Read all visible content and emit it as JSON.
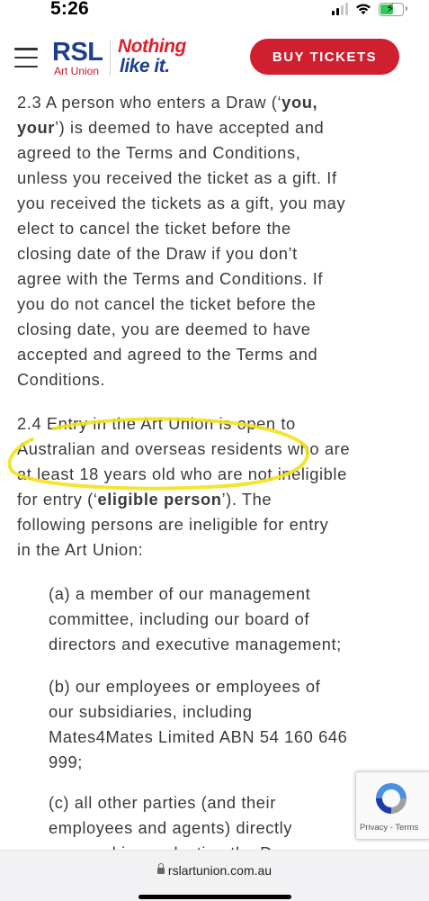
{
  "status_bar": {
    "time": "5:26",
    "battery_charging": true
  },
  "header": {
    "logo_primary": "RSL",
    "logo_sub": "Art Union",
    "logo_slogan_line1": "Nothing",
    "logo_slogan_line2": "like it.",
    "buy_button": "BUY TICKETS"
  },
  "content": {
    "p23_lines": [
      "2.3 A person who enters a Draw (‘you,",
      "your’) is deemed to have accepted and",
      "agreed to the Terms and Conditions,",
      "unless you received the ticket as a gift. If",
      "you received the tickets as a gift, you may",
      "elect to cancel the ticket before the",
      "closing date of the Draw if you don’t",
      "agree with the Terms and Conditions. If",
      "you do not cancel the ticket before the",
      "closing date, you are deemed to have",
      "accepted and agreed to the Terms and",
      "Conditions."
    ],
    "p24_lines": [
      "2.4 Entry in the Art Union is open to",
      "Australian and overseas residents who are",
      "at least 18 years old who are not ineligible",
      "for entry (‘eligible person’). The",
      "following persons are ineligible for entry",
      "in the Art Union:"
    ],
    "pa_lines": [
      "(a) a member of our management",
      "committee, including our board of",
      "directors and executive management;"
    ],
    "pb_lines": [
      "(b) our employees or employees of",
      "our subsidiaries, including",
      "Mates4Mates Limited ABN 54 160 646",
      "999;"
    ],
    "pc_lines": [
      "(c) all other parties (and their",
      "employees and agents) directly",
      "engaged in conducting the Draw;"
    ]
  },
  "recaptcha": {
    "links": "Privacy - Terms"
  },
  "browser": {
    "url": "rslartunion.com.au"
  },
  "colors": {
    "brand_blue": "#1d3f8f",
    "brand_red": "#d01f2e",
    "highlight": "#f2e21c"
  }
}
